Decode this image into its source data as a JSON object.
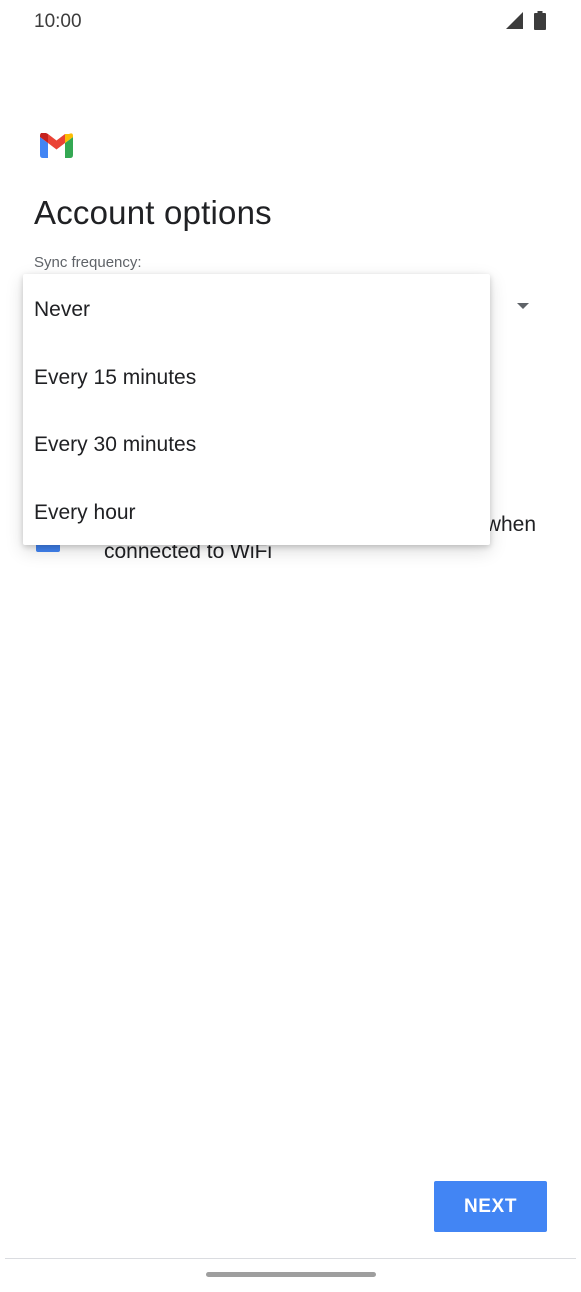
{
  "status_bar": {
    "time": "10:00",
    "icons": [
      "signal-icon",
      "battery-icon"
    ]
  },
  "app": {
    "logo": "gmail-logo",
    "brand_colors": {
      "blue": "#4285f4",
      "red": "#ea4335",
      "yellow": "#fbbc04",
      "green": "#34a853",
      "dark_red": "#c5221f"
    }
  },
  "page": {
    "title": "Account options",
    "sync_label": "Sync frequency:"
  },
  "dropdown": {
    "options": [
      {
        "label": "Never"
      },
      {
        "label": "Every 15 minutes"
      },
      {
        "label": "Every 30 minutes"
      },
      {
        "label": "Every hour"
      }
    ]
  },
  "checkbox_row": {
    "checked": true,
    "label_line1_visible": "when",
    "label_line2": "connected to WiFi",
    "color": "#4285f4"
  },
  "footer": {
    "next_label": "NEXT",
    "accent": "#4285f4"
  }
}
